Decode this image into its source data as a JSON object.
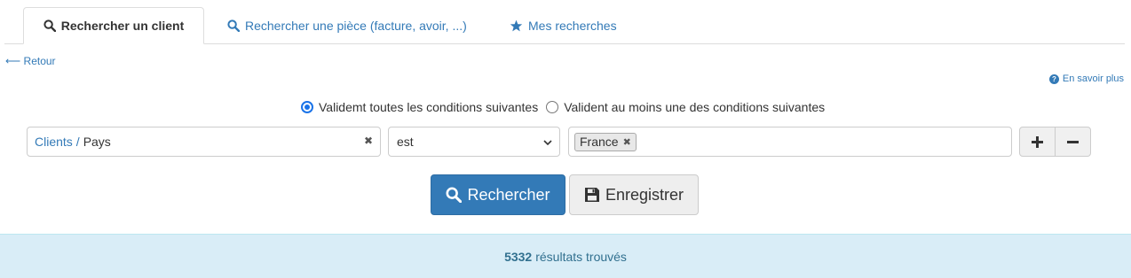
{
  "tabs": [
    {
      "label": "Rechercher un client",
      "icon": "search-icon",
      "active": true
    },
    {
      "label": "Rechercher une pièce (facture, avoir, ...)",
      "icon": "search-icon",
      "active": false
    },
    {
      "label": "Mes recherches",
      "icon": "star-icon",
      "active": false
    }
  ],
  "back_label": "⟵ Retour",
  "help": {
    "label": "En savoir plus",
    "icon_glyph": "?"
  },
  "match_mode": {
    "options": [
      "Validemt toutes les conditions suivantes",
      "Valident au moins une des conditions suivantes"
    ],
    "selected_index": 0
  },
  "condition": {
    "field_path": [
      "Clients",
      "Pays"
    ],
    "field_separator": "/",
    "clear_glyph": "✖",
    "operator": "est",
    "values": [
      {
        "label": "France",
        "remove_glyph": "✖"
      }
    ]
  },
  "actions": {
    "search_label": "Rechercher",
    "save_label": "Enregistrer"
  },
  "results": {
    "count": "5332",
    "suffix": "résultats trouvés"
  },
  "colors": {
    "accent": "#337ab7",
    "info_bg": "#d9edf7",
    "info_text": "#31708f",
    "radio": "#1a73e8"
  }
}
